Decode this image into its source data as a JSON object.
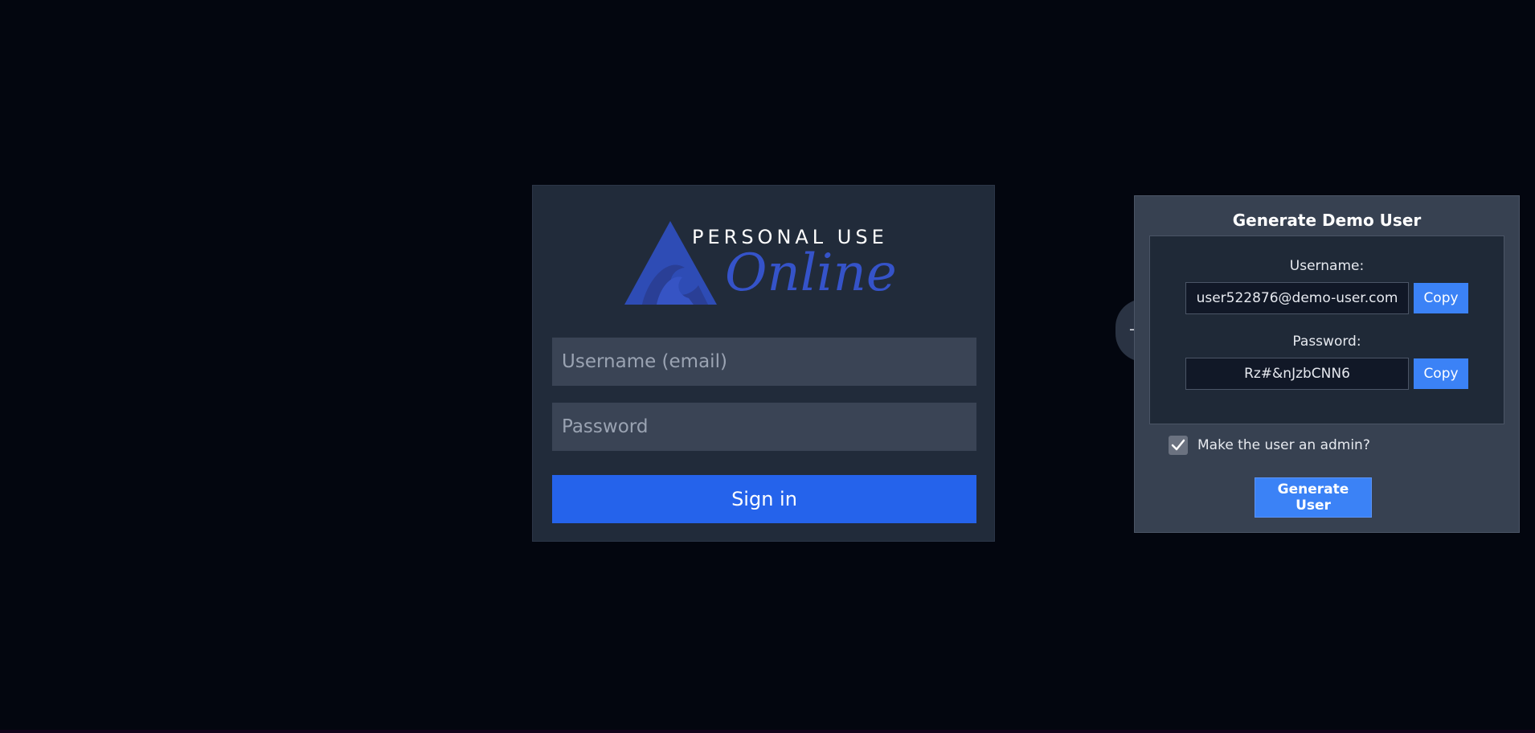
{
  "login": {
    "logo_line1": "PERSONAL USE",
    "logo_line2": "Online",
    "username_placeholder": "Username (email)",
    "password_placeholder": "Password",
    "signin_label": "Sign in"
  },
  "demo_panel": {
    "collapse_label": "−",
    "title": "Generate Demo User",
    "username_label": "Username:",
    "username_value": "user522876@demo-user.com",
    "password_label": "Password:",
    "password_value": "Rz#&nJzbCNN6",
    "copy_label": "Copy",
    "admin_label": "Make the user an admin?",
    "admin_checked": true,
    "generate_label": "Generate User"
  },
  "colors": {
    "background": "#03060f",
    "accent": "#2563eb",
    "logo_blue": "#3553c9",
    "button_blue": "#3b82f6"
  },
  "icons": {
    "logo": "triangle-wave-logo-icon",
    "checkbox": "check-icon"
  }
}
